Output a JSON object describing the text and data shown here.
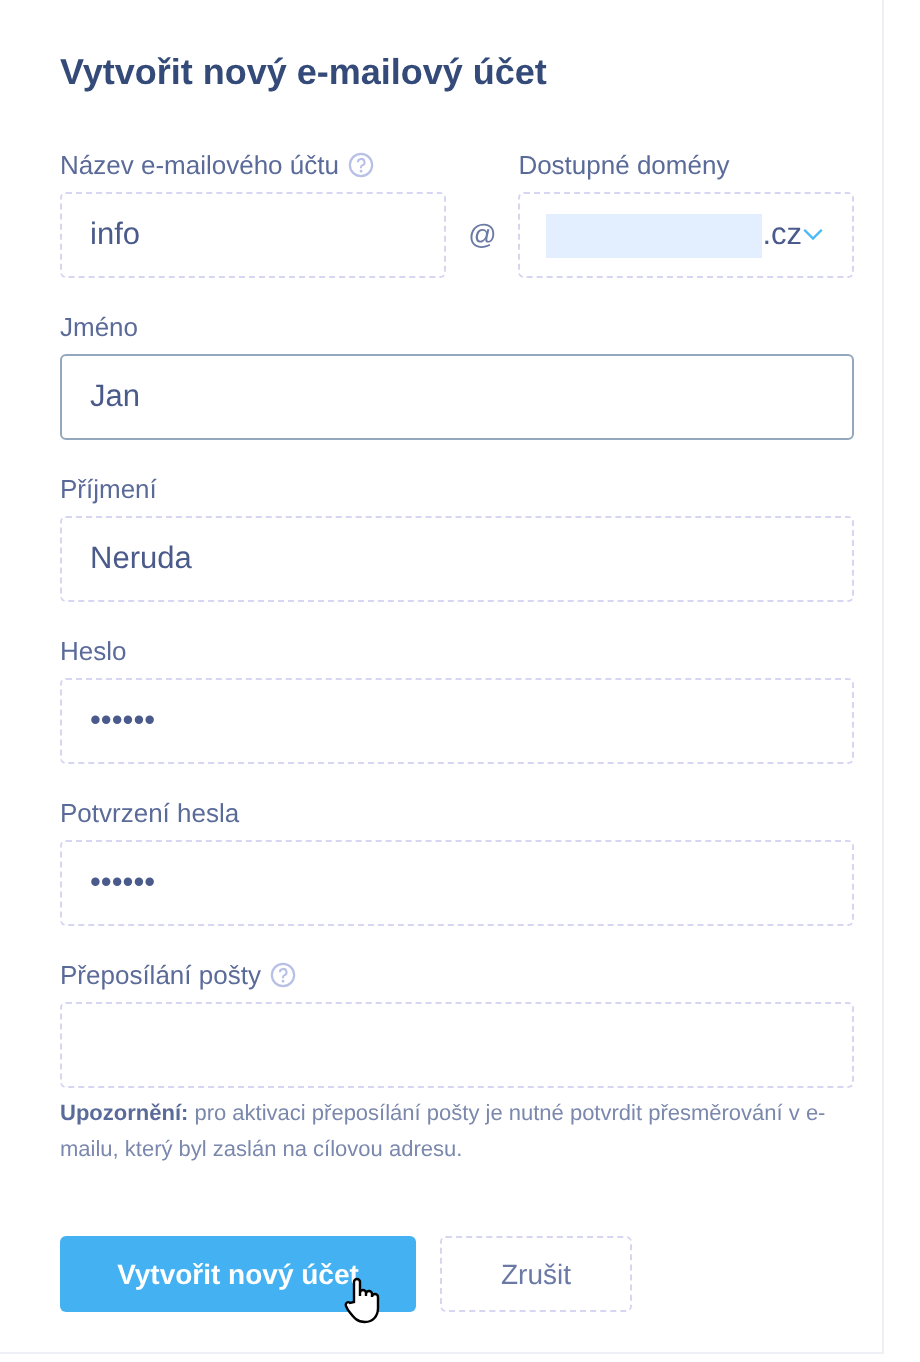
{
  "dialog": {
    "title": "Vytvořit nový e-mailový účet"
  },
  "account_row": {
    "name_field": {
      "label": "Název e-mailového účtu",
      "help": true,
      "value": "info"
    },
    "at_sign": "@",
    "domain_field": {
      "label": "Dostupné domény",
      "redacted": true,
      "value": ".cz"
    }
  },
  "fields": [
    {
      "label": "Jméno",
      "value": "Jan",
      "help": false,
      "focused": true
    },
    {
      "label": "Příjmení",
      "value": "Neruda",
      "help": false,
      "focused": false
    },
    {
      "label": "Heslo",
      "value": "••••••",
      "help": false,
      "focused": false
    },
    {
      "label": "Potvrzení hesla",
      "value": "••••••",
      "help": false,
      "focused": false
    },
    {
      "label": "Přeposílání pošty",
      "help": true,
      "focused": false
    }
  ],
  "note": "**Upozornění:** pro aktivaci přeposílání pošty je nutné potvrdit přesměrování v e-mailu, který byl zaslán na cílovou adresu.",
  "buttons": [
    {
      "label": "Vytvořit nový účet",
      "kind": "primary",
      "hovered": true
    },
    {
      "label": "Zrušit",
      "kind": "secondary",
      "hovered": false
    }
  ]
}
